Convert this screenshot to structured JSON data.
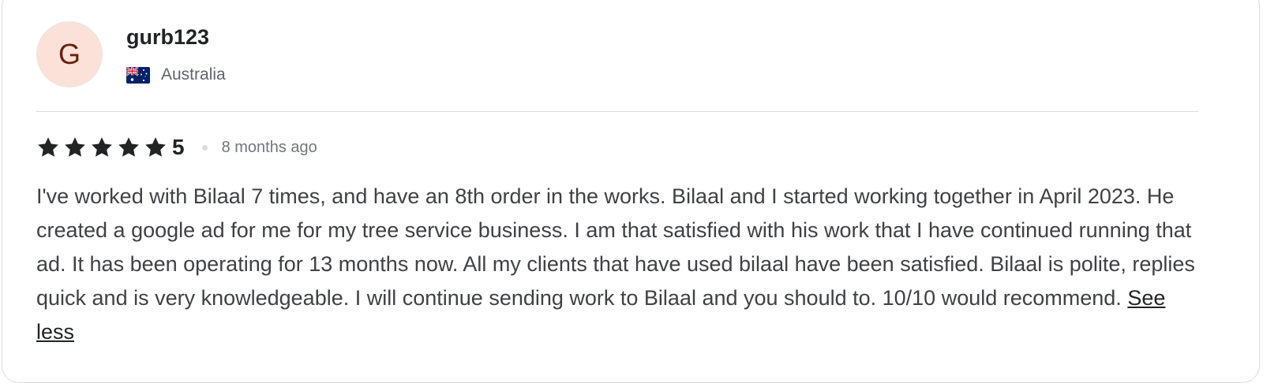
{
  "reviewer": {
    "initial": "G",
    "username": "gurb123",
    "country": "Australia",
    "country_flag": "australia-flag-icon",
    "avatar_bg": "#fbe1d7",
    "avatar_fg": "#6b1f0c"
  },
  "rating": {
    "stars": 5,
    "score": "5",
    "time_ago": "8 months ago"
  },
  "review": {
    "text": "I've worked with Bilaal 7 times, and have an 8th order in the works. Bilaal and I started working together in April 2023. He created a google ad for me for my tree service business. I am that satisfied with his work that I have continued running that ad. It has been operating for 13 months now. All my clients that have used bilaal have been satisfied. Bilaal is polite, replies quick and is very knowledgeable. I will continue sending work to Bilaal and you should to. 10/10 would recommend.",
    "toggle_label": "See less"
  }
}
